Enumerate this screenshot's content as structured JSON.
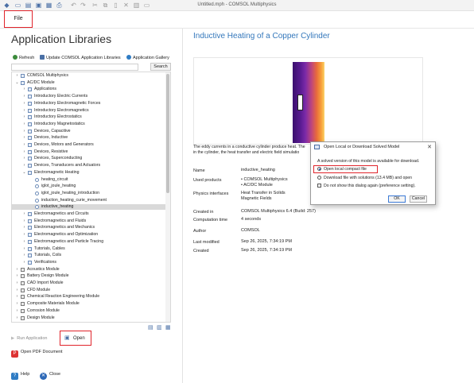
{
  "window": {
    "title": "Untitled.mph - COMSOL Multiphysics"
  },
  "ribbon": {
    "file_tab": "File"
  },
  "library": {
    "title": "Application Libraries",
    "toolbar": {
      "refresh": "Refresh",
      "update": "Update COMSOL Application Libraries",
      "gallery": "Application Gallery"
    },
    "search": {
      "value": "",
      "button": "Search"
    },
    "tree": [
      {
        "label": "COMSOL Multiphysics",
        "depth": 0,
        "expander": "right",
        "icon": "folder"
      },
      {
        "label": "AC/DC Module",
        "depth": 0,
        "expander": "down",
        "icon": "folder"
      },
      {
        "label": "Applications",
        "depth": 1,
        "expander": "right",
        "icon": "folder"
      },
      {
        "label": "Introductory Electric Currents",
        "depth": 1,
        "expander": "right",
        "icon": "folder"
      },
      {
        "label": "Introductory Electromagnetic Forces",
        "depth": 1,
        "expander": "right",
        "icon": "folder"
      },
      {
        "label": "Introductory Electromagnetics",
        "depth": 1,
        "expander": "right",
        "icon": "folder"
      },
      {
        "label": "Introductory Electrostatics",
        "depth": 1,
        "expander": "right",
        "icon": "folder"
      },
      {
        "label": "Introductory Magnetostatics",
        "depth": 1,
        "expander": "right",
        "icon": "folder"
      },
      {
        "label": "Devices, Capacitive",
        "depth": 1,
        "expander": "right",
        "icon": "folder"
      },
      {
        "label": "Devices, Inductive",
        "depth": 1,
        "expander": "right",
        "icon": "folder"
      },
      {
        "label": "Devices, Motors and Generators",
        "depth": 1,
        "expander": "right",
        "icon": "folder"
      },
      {
        "label": "Devices, Resistive",
        "depth": 1,
        "expander": "right",
        "icon": "folder"
      },
      {
        "label": "Devices, Superconducting",
        "depth": 1,
        "expander": "right",
        "icon": "folder"
      },
      {
        "label": "Devices, Transducers and Actuators",
        "depth": 1,
        "expander": "right",
        "icon": "folder"
      },
      {
        "label": "Electromagnetic Heating",
        "depth": 1,
        "expander": "down",
        "icon": "folder"
      },
      {
        "label": "heating_circuit",
        "depth": 2,
        "expander": "",
        "icon": "model"
      },
      {
        "label": "iglot_joule_heating",
        "depth": 2,
        "expander": "",
        "icon": "model"
      },
      {
        "label": "iglot_joule_heating_introduction",
        "depth": 2,
        "expander": "",
        "icon": "model"
      },
      {
        "label": "induction_heating_curie_movement",
        "depth": 2,
        "expander": "",
        "icon": "model"
      },
      {
        "label": "inductive_heating",
        "depth": 2,
        "expander": "",
        "icon": "model",
        "selected": true
      },
      {
        "label": "Electromagnetics and Circuits",
        "depth": 1,
        "expander": "right",
        "icon": "folder"
      },
      {
        "label": "Electromagnetics and Fluids",
        "depth": 1,
        "expander": "right",
        "icon": "folder"
      },
      {
        "label": "Electromagnetics and Mechanics",
        "depth": 1,
        "expander": "right",
        "icon": "folder"
      },
      {
        "label": "Electromagnetics and Optimization",
        "depth": 1,
        "expander": "right",
        "icon": "folder"
      },
      {
        "label": "Electromagnetics and Particle Tracing",
        "depth": 1,
        "expander": "right",
        "icon": "folder"
      },
      {
        "label": "Tutorials, Cables",
        "depth": 1,
        "expander": "right",
        "icon": "folder"
      },
      {
        "label": "Tutorials, Coils",
        "depth": 1,
        "expander": "right",
        "icon": "folder"
      },
      {
        "label": "Verifications",
        "depth": 1,
        "expander": "right",
        "icon": "folder"
      },
      {
        "label": "Acoustics Module",
        "depth": 0,
        "expander": "right",
        "icon": "module"
      },
      {
        "label": "Battery Design Module",
        "depth": 0,
        "expander": "right",
        "icon": "module"
      },
      {
        "label": "CAD Import Module",
        "depth": 0,
        "expander": "right",
        "icon": "module"
      },
      {
        "label": "CFD Module",
        "depth": 0,
        "expander": "right",
        "icon": "module"
      },
      {
        "label": "Chemical Reaction Engineering Module",
        "depth": 0,
        "expander": "right",
        "icon": "module"
      },
      {
        "label": "Composite Materials Module",
        "depth": 0,
        "expander": "right",
        "icon": "module"
      },
      {
        "label": "Corrosion Module",
        "depth": 0,
        "expander": "right",
        "icon": "module"
      },
      {
        "label": "Design Module",
        "depth": 0,
        "expander": "right",
        "icon": "module"
      }
    ],
    "actions": {
      "run_application": "Run Application",
      "open": "Open",
      "open_pdf": "Open PDF Document",
      "help": "Help",
      "close": "Close"
    }
  },
  "model": {
    "title": "Inductive Heating of a Copper Cylinder",
    "caption_line1": "The eddy currents in a conductive cylinder produce heat. The",
    "caption_line2": "in the cylinder, the heat transfer and electric field simulatio",
    "details": {
      "name_label": "Name",
      "name_value": "inductive_heating",
      "products_label": "Used products",
      "products_value_1": "• COMSOL Multiphysics",
      "products_value_2": "• AC/DC Module",
      "interfaces_label": "Physics interfaces",
      "interfaces_value_1": "Heat Transfer in Solids",
      "interfaces_value_2": "Magnetic Fields",
      "created_in_label": "Created in",
      "created_in_value": "COMSOL Multiphysics 6.4 (Build: 257)",
      "computation_label": "Computation time",
      "computation_value": "4 seconds",
      "author_label": "Author",
      "author_value": "COMSOL",
      "modified_label": "Last modified",
      "modified_value": "Sep 26, 2025, 7:34:19 PM",
      "created_label": "Created",
      "created_value": "Sep 26, 2025, 7:34:19 PM"
    }
  },
  "dialog": {
    "title": "Open Local or Download Solved Model",
    "message": "A solved version of this model is available for download.",
    "option_local": "Open local compact file",
    "option_download": "Download file with solutions (13.4 MB) and open",
    "option_remember": "Do not show this dialog again (preference setting).",
    "ok": "OK",
    "cancel": "Cancel",
    "selected": "Open local compact file"
  },
  "colors": {
    "accent": "#3377bb",
    "highlight": "#e0242b"
  }
}
